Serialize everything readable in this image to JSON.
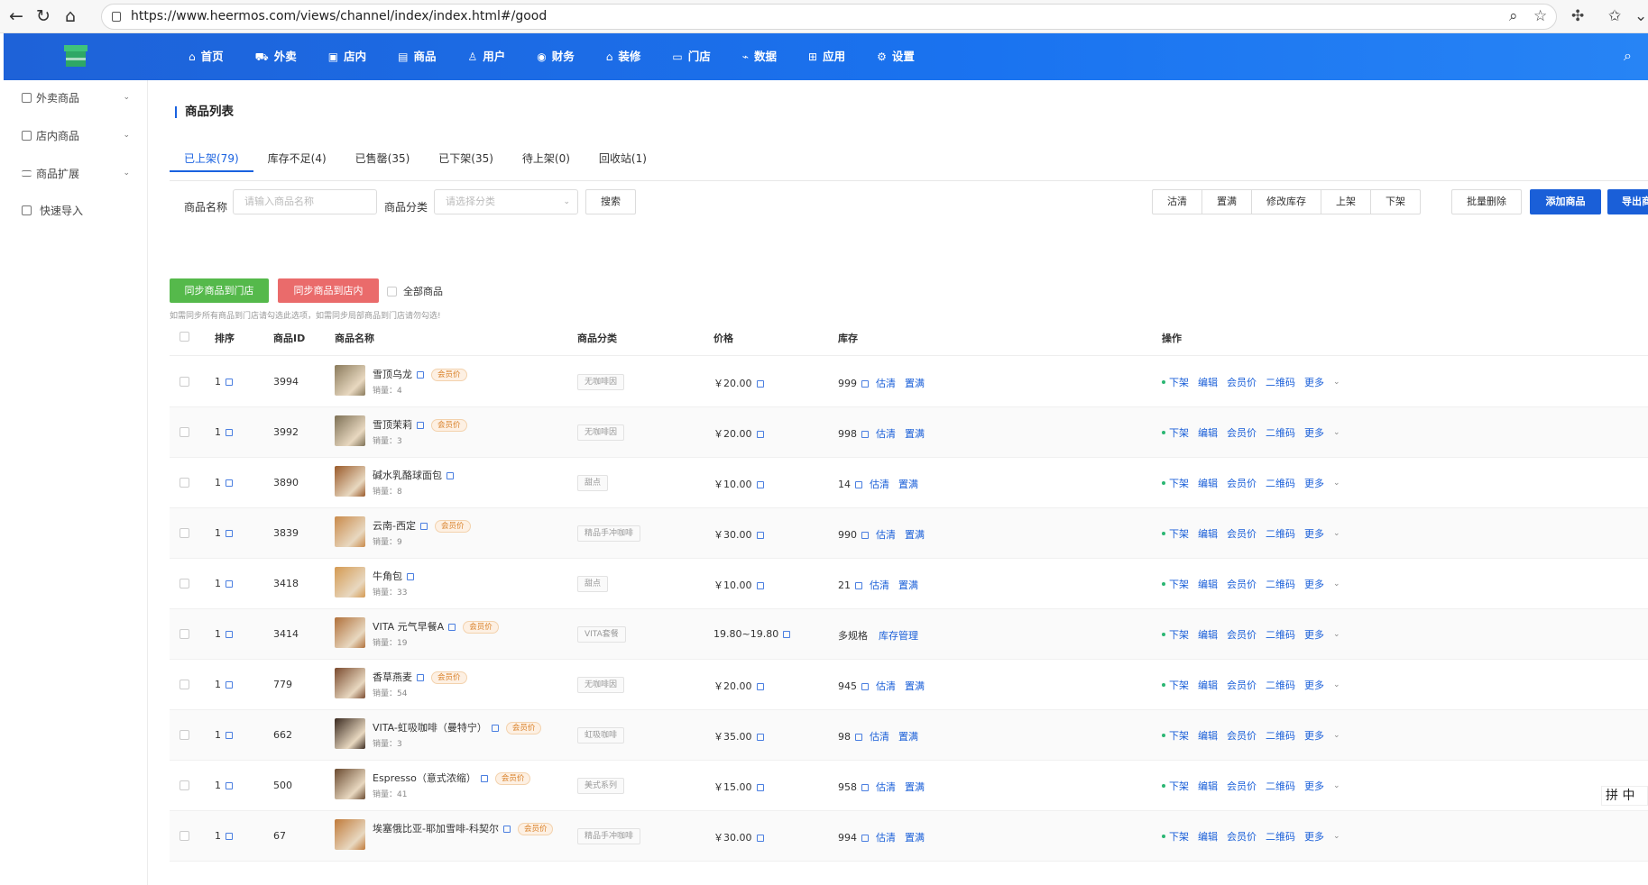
{
  "browser": {
    "url": "https://www.heermos.com/views/channel/index/index.html#/good"
  },
  "topnav": {
    "menu": [
      {
        "label": "首页",
        "icon": "home-icon",
        "glyph": "⌂"
      },
      {
        "label": "外卖",
        "icon": "takeout-icon",
        "glyph": "⛟"
      },
      {
        "label": "店内",
        "icon": "store-icon",
        "glyph": "▣"
      },
      {
        "label": "商品",
        "icon": "product-icon",
        "glyph": "▤"
      },
      {
        "label": "用户",
        "icon": "user-icon",
        "glyph": "♙"
      },
      {
        "label": "财务",
        "icon": "finance-icon",
        "glyph": "◉"
      },
      {
        "label": "装修",
        "icon": "decoration-icon",
        "glyph": "⌂"
      },
      {
        "label": "门店",
        "icon": "shop-icon",
        "glyph": "▭"
      },
      {
        "label": "数据",
        "icon": "chart-icon",
        "glyph": "⌁"
      },
      {
        "label": "应用",
        "icon": "apps-icon",
        "glyph": "⊞"
      },
      {
        "label": "设置",
        "icon": "gear-icon",
        "glyph": "⚙"
      }
    ]
  },
  "sidebar": {
    "items": [
      {
        "label": "外卖商品"
      },
      {
        "label": "店内商品"
      },
      {
        "label": "商品扩展"
      },
      {
        "label": "快速导入"
      }
    ]
  },
  "page": {
    "title": "商品列表",
    "tabs": [
      "已上架(79)",
      "库存不足(4)",
      "已售罄(35)",
      "已下架(35)",
      "待上架(0)",
      "回收站(1)"
    ],
    "filter": {
      "name_label": "商品名称",
      "name_placeholder": "请输入商品名称",
      "category_label": "商品分类",
      "category_placeholder": "请选择分类",
      "search_btn": "搜索"
    },
    "actions": [
      "沽清",
      "置满",
      "修改库存",
      "上架",
      "下架"
    ],
    "batch_delete": "批量删除",
    "add_product": "添加商品",
    "export": "导出商",
    "sync_store": "同步商品到门店",
    "sync_inside": "同步商品到店内",
    "all_products": "全部商品",
    "hint": "如需同步所有商品到门店请勾选此选项，如需同步局部商品到门店请勿勾选!",
    "columns": [
      "排序",
      "商品ID",
      "商品名称",
      "商品分类",
      "价格",
      "库存",
      "操作"
    ]
  },
  "table": {
    "sales_prefix": "销量：",
    "vip_label": "会员价",
    "stock_ops": [
      "估清",
      "置满"
    ],
    "multi_stock_link": "库存管理",
    "row_ops": [
      "下架",
      "编辑",
      "会员价",
      "二维码",
      "更多"
    ],
    "rows": [
      {
        "sort": "1",
        "id": "3994",
        "name": "雪顶乌龙",
        "vip": true,
        "sales": "4",
        "category": "无咖啡因",
        "price": "￥20.00",
        "stock": "999",
        "thumb": "#8a7b5c"
      },
      {
        "sort": "1",
        "id": "3992",
        "name": "雪顶茉莉",
        "vip": true,
        "sales": "3",
        "category": "无咖啡因",
        "price": "￥20.00",
        "stock": "998",
        "thumb": "#7d7055"
      },
      {
        "sort": "1",
        "id": "3890",
        "name": "碱水乳酪球面包",
        "vip": false,
        "sales": "8",
        "category": "甜点",
        "price": "￥10.00",
        "stock": "14",
        "thumb": "#9a5a2a"
      },
      {
        "sort": "1",
        "id": "3839",
        "name": "云南-西定",
        "vip": true,
        "sales": "9",
        "category": "精品手冲咖啡",
        "price": "￥30.00",
        "stock": "990",
        "thumb": "#c98a4a"
      },
      {
        "sort": "1",
        "id": "3418",
        "name": "牛角包",
        "vip": false,
        "sales": "33",
        "category": "甜点",
        "price": "￥10.00",
        "stock": "21",
        "thumb": "#d49a52"
      },
      {
        "sort": "1",
        "id": "3414",
        "name": "VITA 元气早餐A",
        "vip": true,
        "sales": "19",
        "category": "VITA套餐",
        "price": "19.80~19.80",
        "stock": "多规格",
        "multi": true,
        "thumb": "#b0703a"
      },
      {
        "sort": "1",
        "id": "779",
        "name": "香草燕麦",
        "vip": true,
        "sales": "54",
        "category": "无咖啡因",
        "price": "￥20.00",
        "stock": "945",
        "thumb": "#7a4a2e"
      },
      {
        "sort": "1",
        "id": "662",
        "name": "VITA-虹吸咖啡（曼特宁）",
        "vip": true,
        "sales": "3",
        "category": "虹吸咖啡",
        "price": "￥35.00",
        "stock": "98",
        "thumb": "#3a2a20"
      },
      {
        "sort": "1",
        "id": "500",
        "name": "Espresso（意式浓缩）",
        "vip": true,
        "sales": "41",
        "category": "美式系列",
        "price": "￥15.00",
        "stock": "958",
        "thumb": "#6a4a30"
      },
      {
        "sort": "1",
        "id": "67",
        "name": "埃塞俄比亚-耶加雪啡-科契尔",
        "vip": true,
        "sales": "",
        "category": "精品手冲咖啡",
        "price": "￥30.00",
        "stock": "994",
        "thumb": "#c07a3a"
      }
    ]
  },
  "ime": {
    "label": "拼 中"
  }
}
